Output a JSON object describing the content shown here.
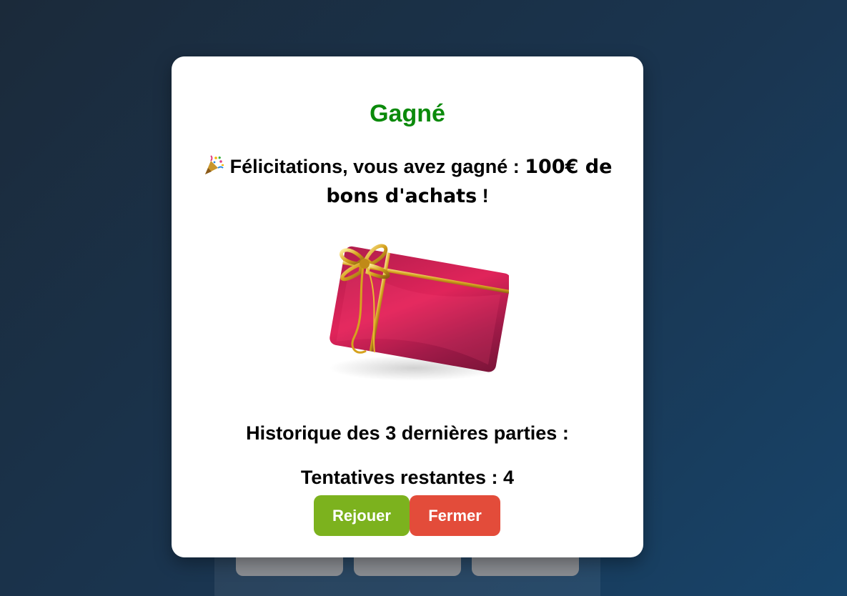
{
  "modal": {
    "title": "Gagné",
    "congrats_text": "Félicitations, vous avez gagné : ",
    "prize": "100€ de bons d'achats",
    "congrats_suffix": " !",
    "history_label": "Historique des 3 dernières parties :",
    "attempts_label": "Tentatives restantes : ",
    "attempts_remaining": "4",
    "replay_button": "Rejouer",
    "close_button": "Fermer"
  },
  "icons": {
    "party": "party-popper-icon",
    "gift": "gift-card-image"
  },
  "colors": {
    "title": "#0b8a0b",
    "replay_button": "#7cb21e",
    "close_button": "#e34c3a"
  }
}
